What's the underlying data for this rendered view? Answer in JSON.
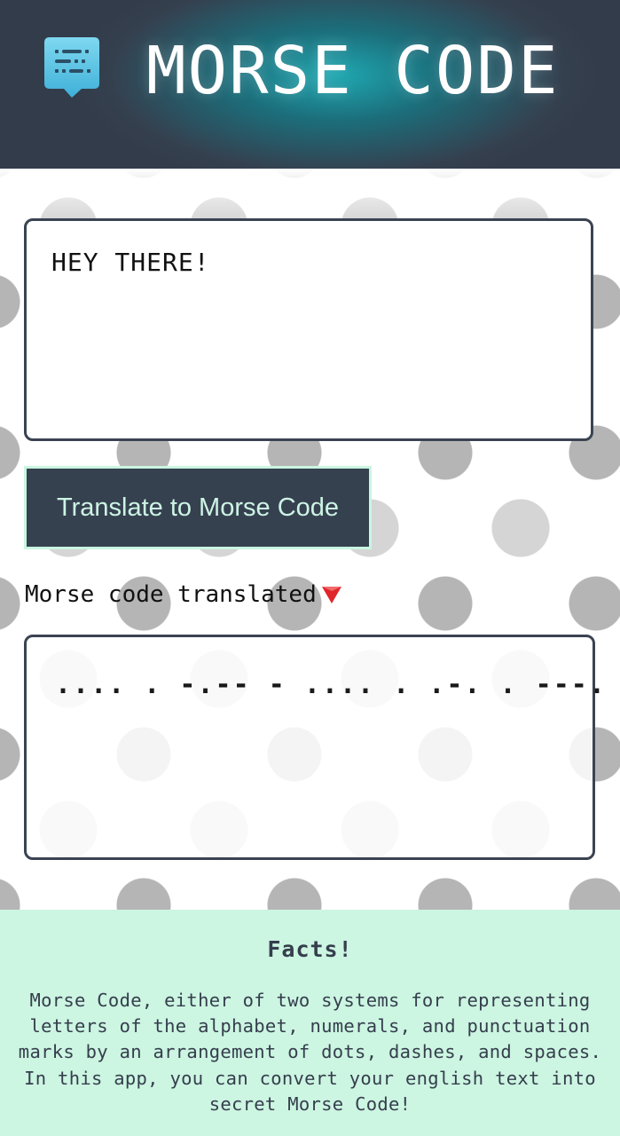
{
  "header": {
    "title": "MORSE CODE",
    "logo_icon": "chat-bubble-morse-icon"
  },
  "input": {
    "value": "HEY THERE!"
  },
  "translate_button": {
    "label": "Translate to Morse Code"
  },
  "result": {
    "label": "Morse code translated",
    "label_icon": "red-down-triangle-icon",
    "value": ".... . -.-- - .... . .-. . ---."
  },
  "facts": {
    "title": "Facts!",
    "lines": [
      "Morse Code, either of two systems for representing",
      "letters of the alphabet, numerals, and punctuation",
      "marks by an arrangement of dots, dashes, and spaces.",
      "In this app, you can convert your english text into",
      "secret Morse Code!"
    ]
  },
  "colors": {
    "header_dark": "#323c4b",
    "header_glow": "#1ea7b0",
    "button_bg": "#364150",
    "button_text": "#cdf4e4",
    "facts_bg": "#ccf5e2",
    "triangle": "#e0262b"
  }
}
